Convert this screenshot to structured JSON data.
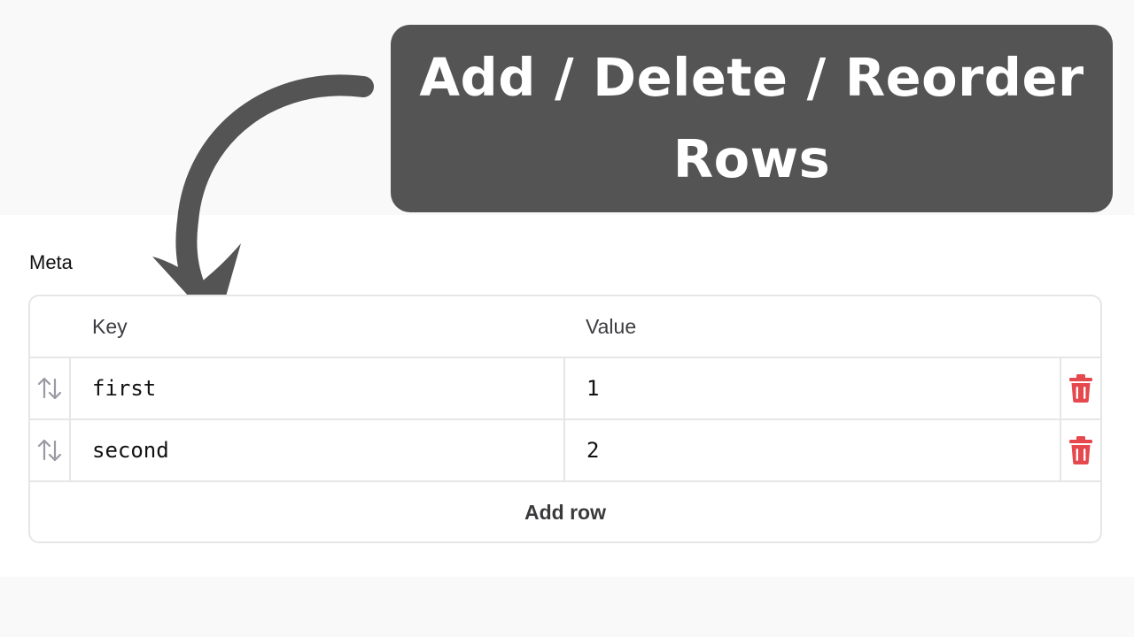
{
  "banner": {
    "title_line1": "Add / Delete / Reorder",
    "title_line2": "Rows"
  },
  "section": {
    "label": "Meta"
  },
  "table": {
    "columns": [
      "Key",
      "Value"
    ],
    "rows": [
      {
        "key": "first",
        "value": "1"
      },
      {
        "key": "second",
        "value": "2"
      }
    ],
    "add_row_label": "Add row"
  },
  "icons": {
    "arrow": "curved-arrow-icon",
    "reorder": "sort-arrows-icon",
    "delete": "trash-icon"
  },
  "colors": {
    "banner_bg": "#545454",
    "delete_icon": "#e5484d",
    "reorder_icon": "#9a9aa2",
    "border": "#e6e6e8"
  }
}
